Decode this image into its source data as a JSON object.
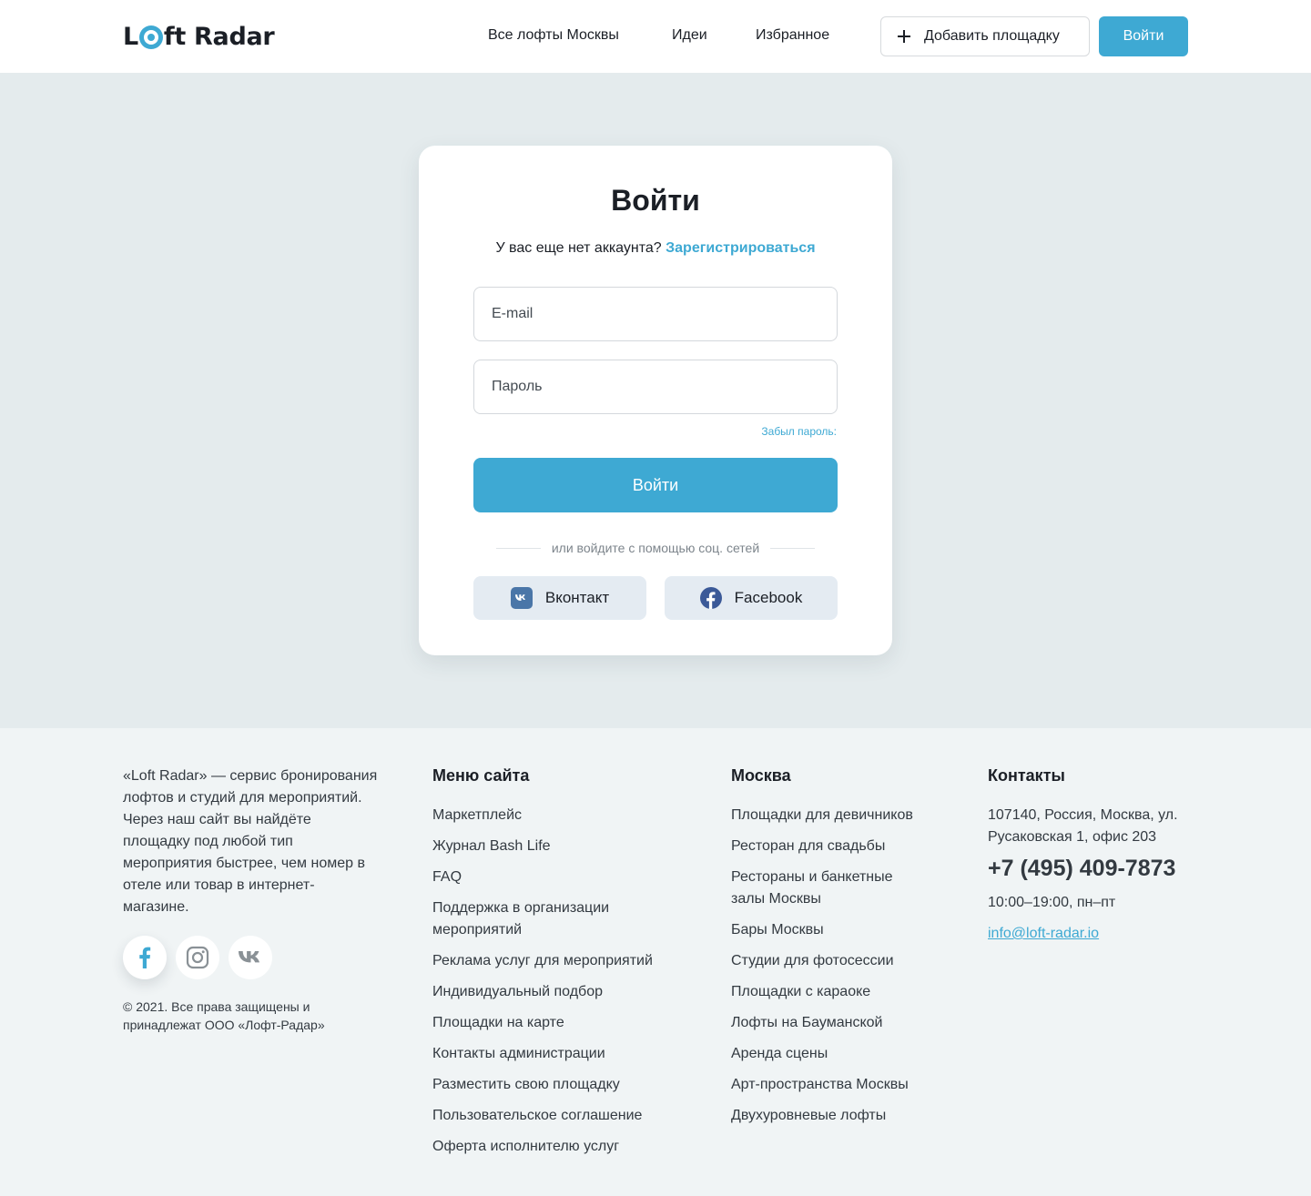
{
  "header": {
    "logo_prefix": "L",
    "logo_suffix": "ft Radar",
    "nav": [
      "Все лофты Москвы",
      "Идеи",
      "Избранное"
    ],
    "add_venue_label": "Добавить площадку",
    "login_label": "Войти"
  },
  "login_form": {
    "title": "Войти",
    "no_account_text": "У вас еще нет аккаунта?",
    "register_link": "Зарегистрироваться",
    "email_placeholder": "E-mail",
    "password_placeholder": "Пароль",
    "forgot_password": "Забыл пароль:",
    "submit_label": "Войти",
    "social_divider": "или войдите с помощью соц. сетей",
    "vk_label": "Вконтакт",
    "facebook_label": "Facebook"
  },
  "footer": {
    "about": "«Loft Radar» — сервис бронирования лофтов и студий для мероприятий. Через наш сайт вы найдёте площадку под любой тип мероприятия быстрее, чем номер в отеле или товар в интернет-магазине.",
    "copyright": "© 2021. Все права защищены и принадлежат ООО «Лофт-Радар»",
    "menu": {
      "title": "Меню сайта",
      "items": [
        "Маркетплейс",
        "Журнал Bash Life",
        "FAQ",
        "Поддержка в организации мероприятий",
        "Реклама услуг для мероприятий",
        "Индивидуальный подбор",
        "Площадки на карте",
        "Контакты администрации",
        "Разместить свою площадку",
        "Пользовательское соглашение",
        "Оферта исполнителю услуг"
      ]
    },
    "moscow": {
      "title": "Москва",
      "items": [
        "Площадки для девичников",
        "Ресторан для свадьбы",
        "Рестораны и банкетные залы Москвы",
        "Бары Москвы",
        "Студии для фотосессии",
        "Площадки с караоке",
        "Лофты на Бауманской",
        "Аренда сцены",
        "Арт-пространства Москвы",
        "Двухуровневые лофты"
      ]
    },
    "contacts": {
      "title": "Контакты",
      "address": "107140, Россия, Москва, ул. Русаковская 1, офис 203",
      "phone": "+7 (495) 409-7873",
      "hours": "10:00–19:00, пн–пт",
      "email": "info@loft-radar.io"
    }
  },
  "colors": {
    "accent": "#3ea9d3",
    "main_bg": "#e4ebed",
    "footer_bg": "#f0f4f5",
    "vk": "#4a76a8",
    "facebook": "#3b5998"
  },
  "icons": [
    "plus-icon",
    "vk-icon",
    "facebook-icon",
    "instagram-icon"
  ]
}
